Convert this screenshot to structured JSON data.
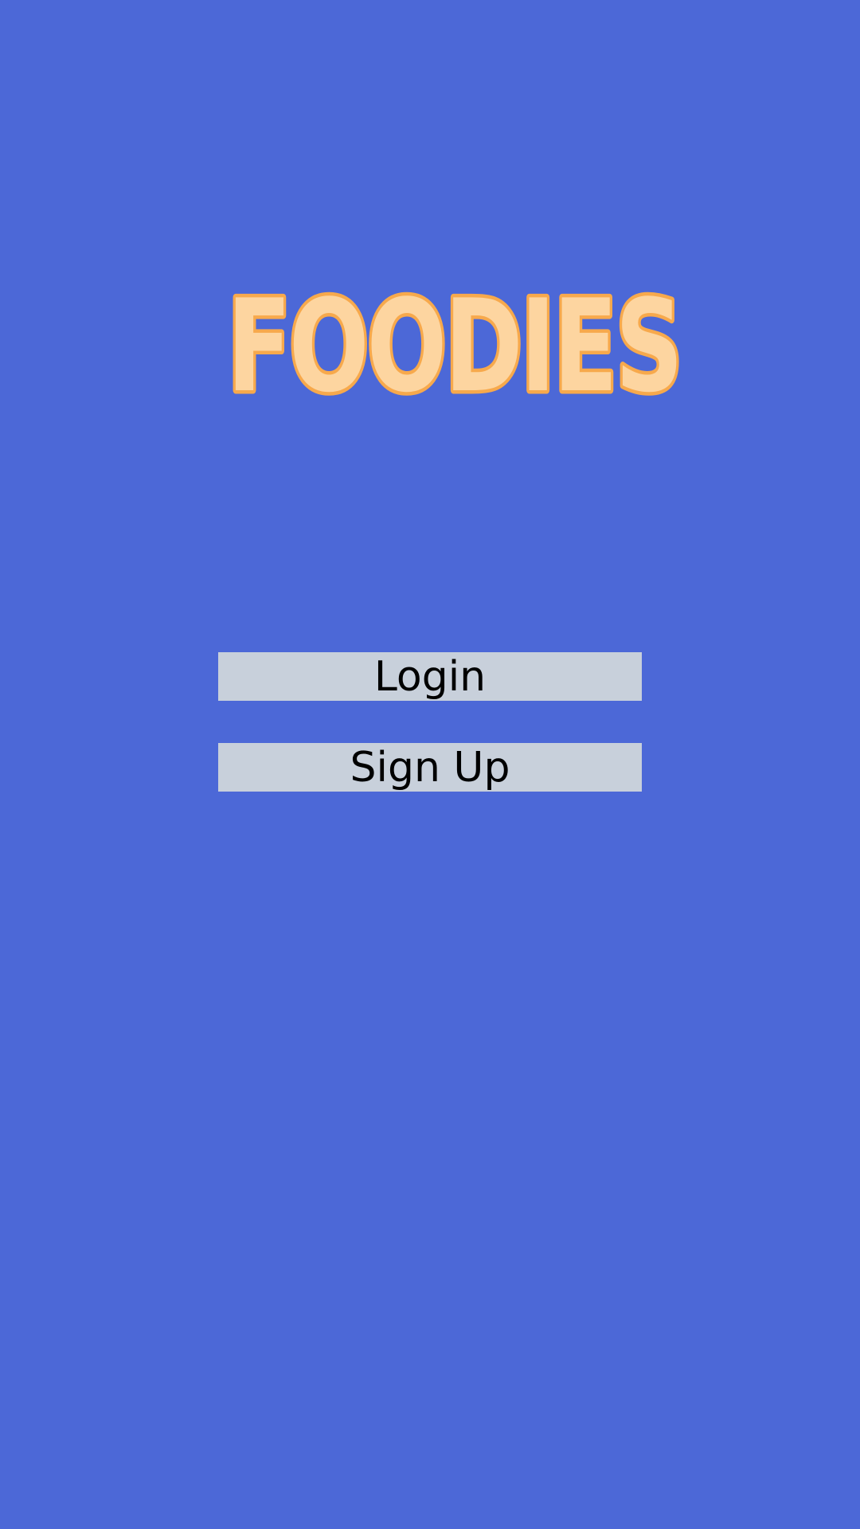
{
  "app": {
    "logo_text": "FOODIES",
    "background_color": "#4c68d7",
    "logo_fill_color": "#fdd5a0",
    "logo_outline_color": "#f7a94c"
  },
  "actions": {
    "login_label": "Login",
    "signup_label": "Sign Up",
    "button_color": "#c8d0db"
  }
}
